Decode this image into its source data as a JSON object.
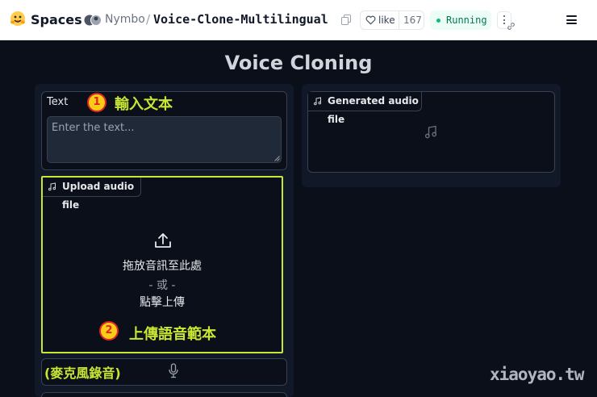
{
  "header": {
    "brand": "Spaces",
    "owner": "Nymbo",
    "separator": "/",
    "repo": "Voice-Clone-Multilingual",
    "like_label": "like",
    "like_count": "167",
    "status": "Running"
  },
  "app": {
    "title": "Voice Cloning",
    "text_input": {
      "label": "Text",
      "placeholder": "Enter the text..."
    },
    "upload": {
      "tab_label": "Upload audio file",
      "drop_text": "拖放音訊至此處",
      "or_text": "- 或 -",
      "click_text": "點擊上傳"
    },
    "output": {
      "tab_label": "Generated audio file"
    }
  },
  "annotations": {
    "step1_number": "1",
    "step1_text": "輸入文本",
    "step2_number": "2",
    "step2_text": "上傳語音範本",
    "mic_note": "(麥克風錄音)"
  },
  "watermark": "xiaoyao.tw",
  "colors": {
    "background": "#0b0f19",
    "panel": "#111827",
    "highlight": "#c8e632",
    "badge_fill": "#facc15",
    "badge_ring": "#dc2626",
    "status_green": "#10b981"
  },
  "icons": {
    "brand": "hugging-face-logo",
    "copy": "copy-icon",
    "like": "heart-icon",
    "menu": "hamburger-icon",
    "upload": "upload-icon",
    "audio": "music-note-icon",
    "mic": "microphone-icon"
  }
}
